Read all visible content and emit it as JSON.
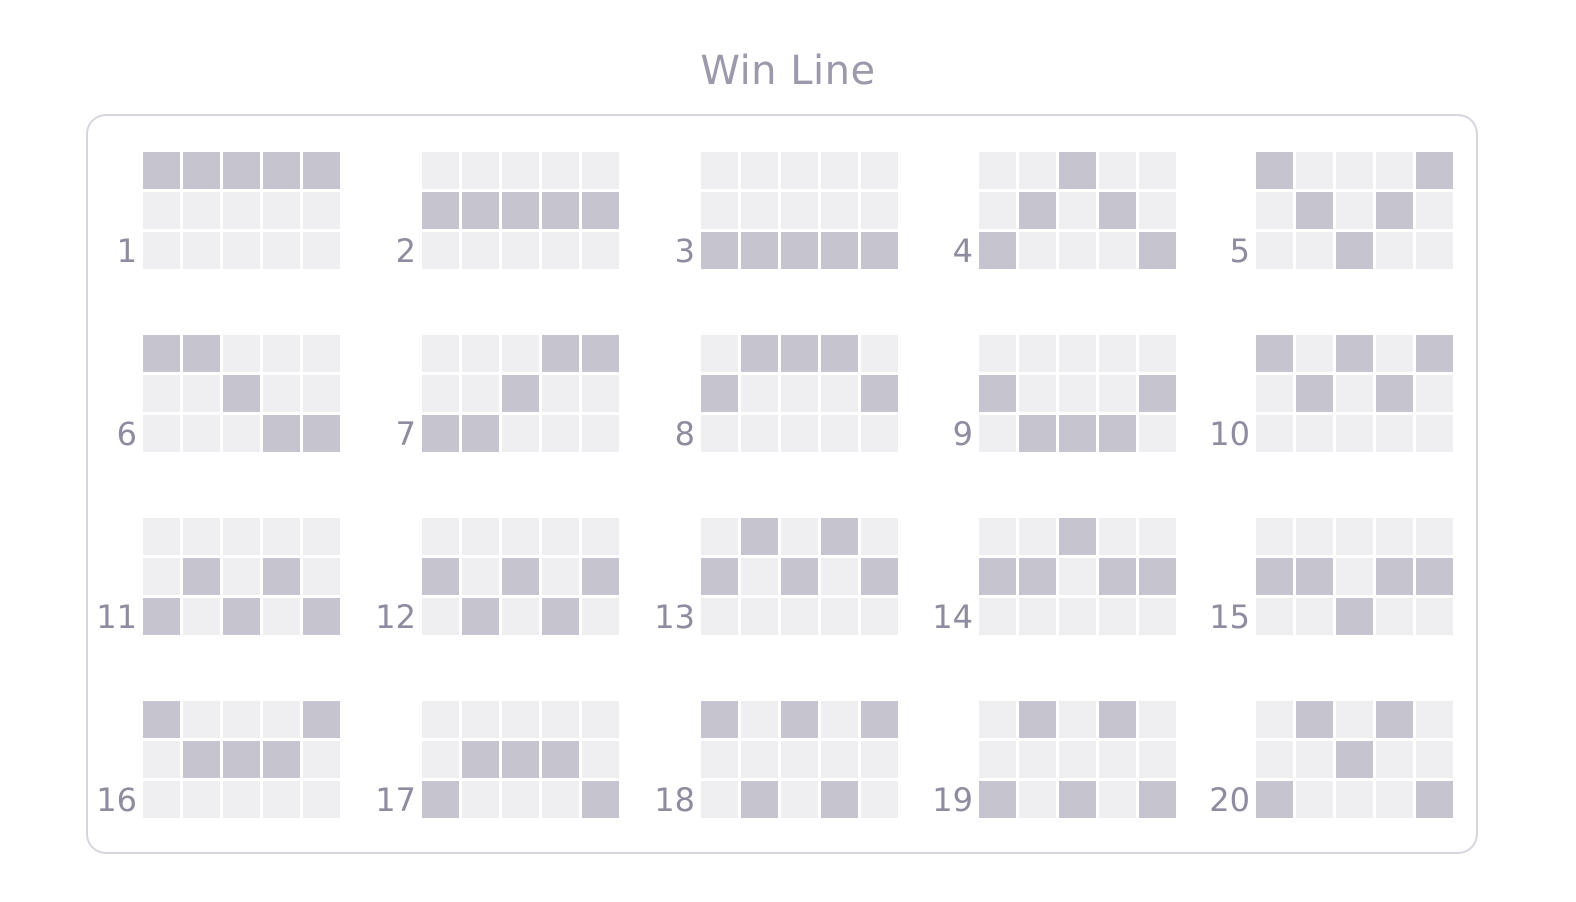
{
  "title": "Win Line",
  "colors": {
    "active_cell": "#c6c5cf",
    "inactive_cell": "#efeff2",
    "text": "#8e8c9f",
    "border": "#d7d6de"
  },
  "lines": [
    {
      "number": "1",
      "pattern": [
        0,
        0,
        0,
        0,
        0
      ]
    },
    {
      "number": "2",
      "pattern": [
        1,
        1,
        1,
        1,
        1
      ]
    },
    {
      "number": "3",
      "pattern": [
        2,
        2,
        2,
        2,
        2
      ]
    },
    {
      "number": "4",
      "pattern": [
        2,
        1,
        0,
        1,
        2
      ]
    },
    {
      "number": "5",
      "pattern": [
        0,
        1,
        2,
        1,
        0
      ]
    },
    {
      "number": "6",
      "pattern": [
        0,
        0,
        1,
        2,
        2
      ]
    },
    {
      "number": "7",
      "pattern": [
        2,
        2,
        1,
        0,
        0
      ]
    },
    {
      "number": "8",
      "pattern": [
        1,
        0,
        0,
        0,
        1
      ]
    },
    {
      "number": "9",
      "pattern": [
        1,
        2,
        2,
        2,
        1
      ]
    },
    {
      "number": "10",
      "pattern": [
        0,
        1,
        0,
        1,
        0
      ]
    },
    {
      "number": "11",
      "pattern": [
        2,
        1,
        2,
        1,
        2
      ]
    },
    {
      "number": "12",
      "pattern": [
        1,
        2,
        1,
        2,
        1
      ]
    },
    {
      "number": "13",
      "pattern": [
        1,
        0,
        1,
        0,
        1
      ]
    },
    {
      "number": "14",
      "pattern": [
        1,
        1,
        0,
        1,
        1
      ]
    },
    {
      "number": "15",
      "pattern": [
        1,
        1,
        2,
        1,
        1
      ]
    },
    {
      "number": "16",
      "pattern": [
        0,
        1,
        1,
        1,
        0
      ]
    },
    {
      "number": "17",
      "pattern": [
        2,
        1,
        1,
        1,
        2
      ]
    },
    {
      "number": "18",
      "pattern": [
        0,
        2,
        0,
        2,
        0
      ]
    },
    {
      "number": "19",
      "pattern": [
        2,
        0,
        2,
        0,
        2
      ]
    },
    {
      "number": "20",
      "pattern": [
        2,
        0,
        1,
        0,
        2
      ]
    }
  ]
}
